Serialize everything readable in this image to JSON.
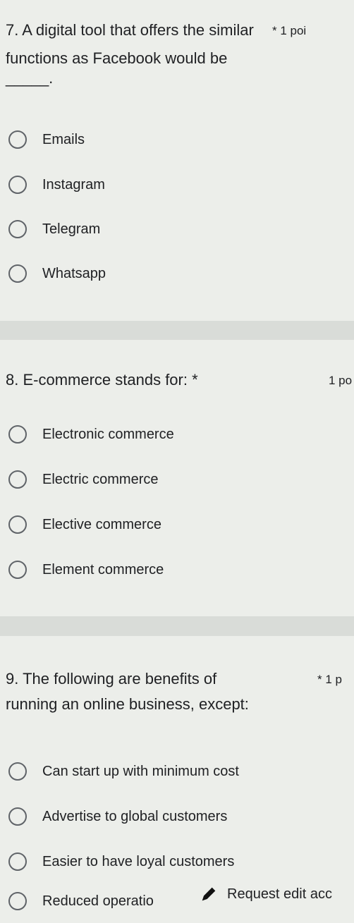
{
  "q7": {
    "title_line1": "7. A digital tool that offers the similar",
    "points": "* 1 poi",
    "title_line2": "functions as Facebook would be",
    "blank": "_____.",
    "options": [
      "Emails",
      "Instagram",
      "Telegram",
      "Whatsapp"
    ]
  },
  "q8": {
    "title": "8. E-commerce stands for: *",
    "points": "1 po",
    "options": [
      "Electronic commerce",
      "Electric commerce",
      "Elective commerce",
      "Element commerce"
    ]
  },
  "q9": {
    "title_line1": "9. The following are benefits of",
    "points": "* 1 p",
    "title_line2": "running an online business, except:",
    "options": [
      "Can start up with minimum cost",
      "Advertise to global customers",
      "Easier to have loyal customers",
      "Reduced operatio"
    ]
  },
  "floating": {
    "edit_label": "Request edit acc",
    "edit_icon": "pencil-icon"
  }
}
